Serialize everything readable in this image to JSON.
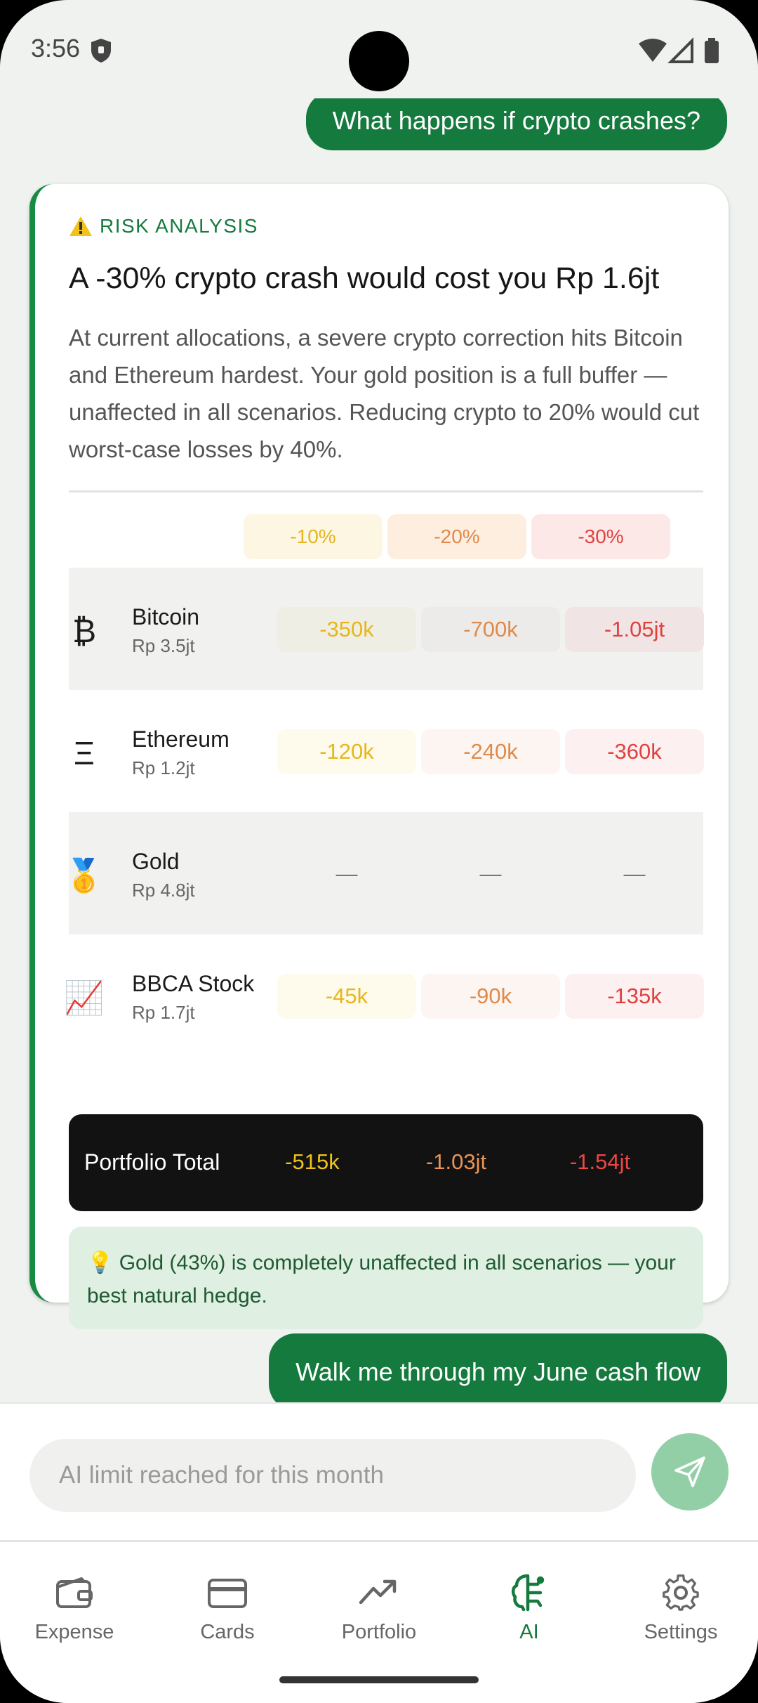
{
  "status": {
    "time": "3:56"
  },
  "messages": {
    "user_top": "What happens if crypto crashes?",
    "user_bottom": "Walk me through my June cash flow"
  },
  "card": {
    "tag": "RISK ANALYSIS",
    "title": "A -30% crypto crash would cost you Rp 1.6jt",
    "description": "At current allocations, a severe crypto correction hits Bitcoin and Ethereum hardest. Your gold position is a full buffer — unaffected in all scenarios. Reducing crypto to 20% would cut worst-case losses by 40%.",
    "scenarios": [
      "-10%",
      "-20%",
      "-30%"
    ],
    "assets": [
      {
        "icon": "₿",
        "name": "Bitcoin",
        "amount": "Rp 3.5jt",
        "values": [
          "-350k",
          "-700k",
          "-1.05jt"
        ]
      },
      {
        "icon": "Ξ",
        "name": "Ethereum",
        "amount": "Rp 1.2jt",
        "values": [
          "-120k",
          "-240k",
          "-360k"
        ]
      },
      {
        "icon": "🥇",
        "name": "Gold",
        "amount": "Rp 4.8jt",
        "values": [
          "—",
          "—",
          "—"
        ]
      },
      {
        "icon": "📈",
        "name": "BBCA Stock",
        "amount": "Rp 1.7jt",
        "values": [
          "-45k",
          "-90k",
          "-135k"
        ]
      }
    ],
    "total": {
      "label": "Portfolio Total",
      "values": [
        "-515k",
        "-1.03jt",
        "-1.54jt"
      ]
    },
    "tip": "💡 Gold (43%) is completely unaffected in all scenarios — your best natural hedge."
  },
  "composer": {
    "placeholder": "AI limit reached for this month"
  },
  "nav": [
    {
      "label": "Expense",
      "icon": "wallet-icon"
    },
    {
      "label": "Cards",
      "icon": "card-icon"
    },
    {
      "label": "Portfolio",
      "icon": "trending-up-icon"
    },
    {
      "label": "AI",
      "icon": "brain-icon",
      "active": true
    },
    {
      "label": "Settings",
      "icon": "gear-icon"
    }
  ],
  "colors": {
    "accent": "#157a3e",
    "yellow": "#e8b61a",
    "orange": "#e08a4a",
    "red": "#e0413f"
  }
}
